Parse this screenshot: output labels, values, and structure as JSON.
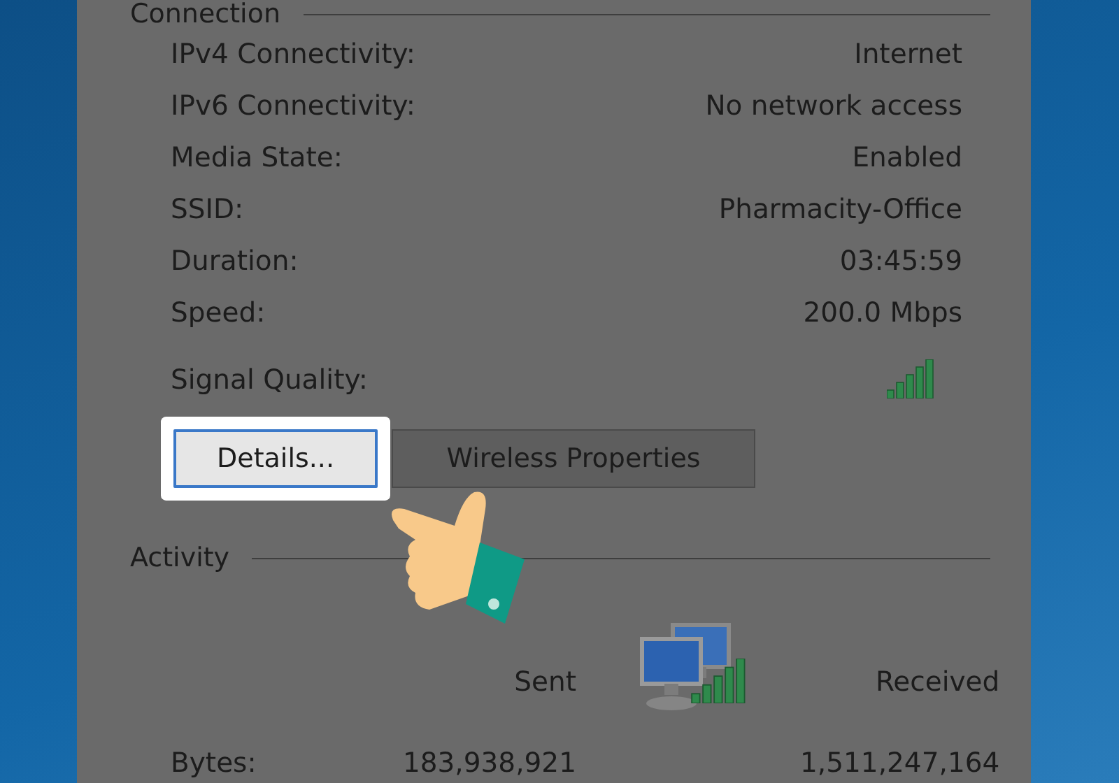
{
  "connection": {
    "title": "Connection",
    "rows": [
      {
        "label": "IPv4 Connectivity:",
        "value": "Internet"
      },
      {
        "label": "IPv6 Connectivity:",
        "value": "No network access"
      },
      {
        "label": "Media State:",
        "value": "Enabled"
      },
      {
        "label": "SSID:",
        "value": "Pharmacity-Office"
      },
      {
        "label": "Duration:",
        "value": "03:45:59"
      },
      {
        "label": "Speed:",
        "value": "200.0 Mbps"
      }
    ],
    "signal_quality": {
      "label": "Signal Quality:"
    },
    "buttons": [
      {
        "label": "Details...",
        "selected": true
      },
      {
        "label": "Wireless Properties",
        "selected": false
      }
    ]
  },
  "activity": {
    "title": "Activity",
    "sent": "Sent",
    "received": "Received",
    "bytes": {
      "label": "Bytes:",
      "sent": "183,938,921",
      "received": "1,511,247,164"
    }
  }
}
